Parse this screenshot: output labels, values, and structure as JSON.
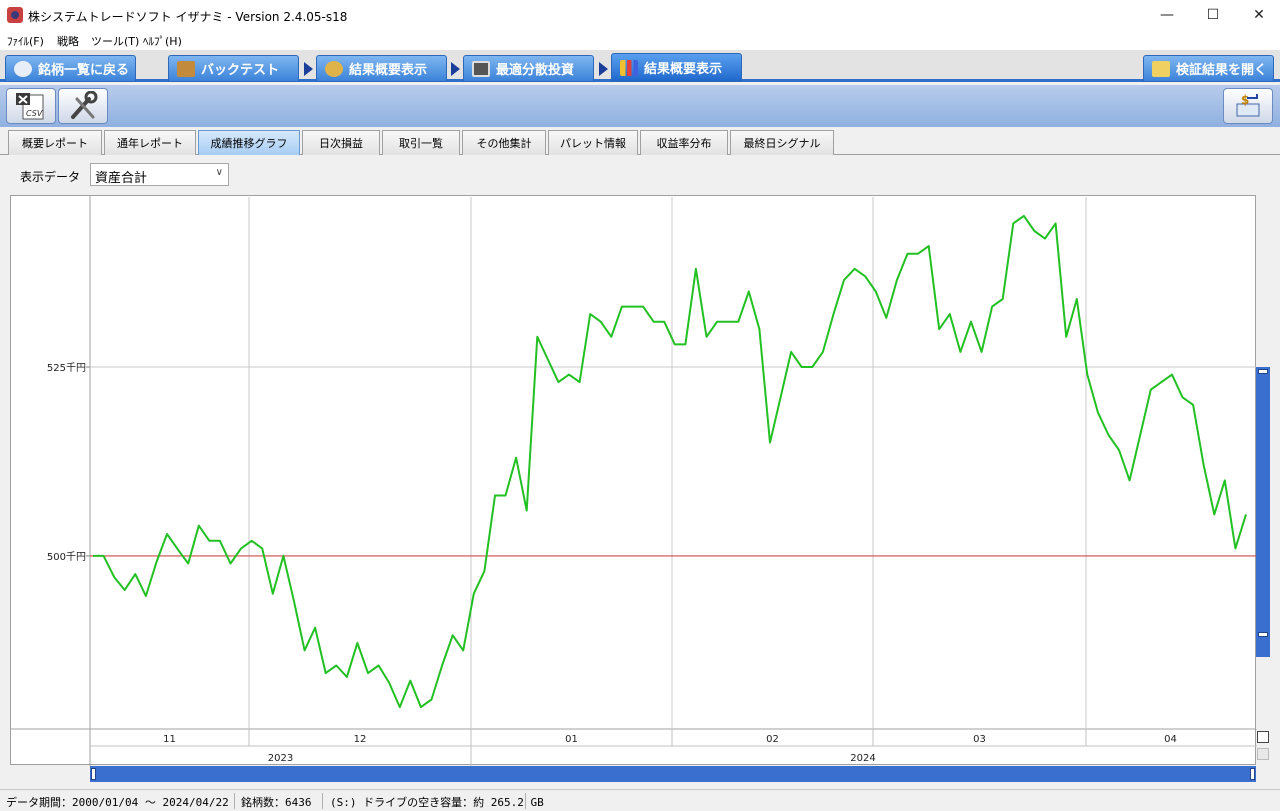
{
  "window": {
    "title": "株システムトレードソフト イザナミ - Version 2.4.05-s18",
    "minimize": "—",
    "maximize": "☐",
    "close": "✕"
  },
  "menu": [
    {
      "label": "ﾌｧｲﾙ(F)"
    },
    {
      "label": "戦略"
    },
    {
      "label": "ツール(T)"
    },
    {
      "label": "ﾍﾙﾌﾟ(H)"
    }
  ],
  "flow": {
    "back_label": "銘柄一覧に戻る",
    "steps": [
      {
        "label": "バックテスト",
        "icon": "bag-icon"
      },
      {
        "label": "結果概要表示",
        "icon": "coins-icon"
      },
      {
        "label": "最適分散投資",
        "icon": "calculator-icon"
      },
      {
        "label": "結果概要表示",
        "icon": "bar-chart-icon"
      }
    ],
    "open_results_label": "検証結果を開く"
  },
  "tabs": [
    {
      "label": "概要レポート"
    },
    {
      "label": "通年レポート"
    },
    {
      "label": "成績推移グラフ",
      "active": true
    },
    {
      "label": "日次損益"
    },
    {
      "label": "取引一覧"
    },
    {
      "label": "その他集計"
    },
    {
      "label": "パレット情報"
    },
    {
      "label": "収益率分布"
    },
    {
      "label": "最終日シグナル"
    }
  ],
  "selector": {
    "label": "表示データ",
    "value": "資産合計"
  },
  "colors": {
    "series": "#22c022",
    "baseline": "#d04848",
    "accent": "#2f6fc8"
  },
  "chart_data": {
    "type": "line",
    "series": [
      {
        "values": [
          500,
          500,
          497.2,
          495.5,
          497.6,
          494.7,
          499.2,
          502.9,
          500.9,
          499,
          504,
          502,
          502,
          499,
          501,
          502,
          501,
          495,
          500,
          494,
          487.5,
          490.5,
          484.5,
          485.5,
          484,
          488.5,
          484.5,
          485.5,
          483.2,
          480,
          483.5,
          480,
          481,
          485.5,
          489.5,
          487.5,
          495,
          498,
          508,
          508,
          513,
          506,
          529,
          526,
          523,
          524,
          523,
          532,
          531,
          529,
          533,
          533,
          533,
          531,
          531,
          528,
          528,
          538,
          529,
          531,
          531,
          531,
          535,
          530,
          515,
          521,
          527,
          525,
          525,
          527,
          532,
          536.5,
          538,
          537,
          535,
          531.5,
          536.5,
          540,
          540,
          541,
          530,
          532,
          527,
          531,
          527,
          533,
          534,
          544,
          545,
          543,
          542,
          544,
          529,
          534,
          524,
          519,
          516,
          514,
          510,
          516,
          522,
          523,
          524,
          521,
          520,
          512,
          505.5,
          510,
          501,
          505.5
        ]
      }
    ],
    "y_ticks": [
      {
        "value": 525,
        "label": "525千円"
      },
      {
        "value": 500,
        "label": "500千円"
      }
    ],
    "baseline": 500,
    "ylim": [
      477.1,
      547.5
    ],
    "months": [
      "11",
      "12",
      "01",
      "02",
      "03",
      "04"
    ],
    "years": [
      "2023",
      "2024"
    ],
    "grid": true
  },
  "status": {
    "period": "データ期間：2000/01/04 ～ 2024/04/22",
    "count": "銘柄数：6436",
    "disk": "(S:) ドライブの空き容量：約 265.2 GB"
  }
}
